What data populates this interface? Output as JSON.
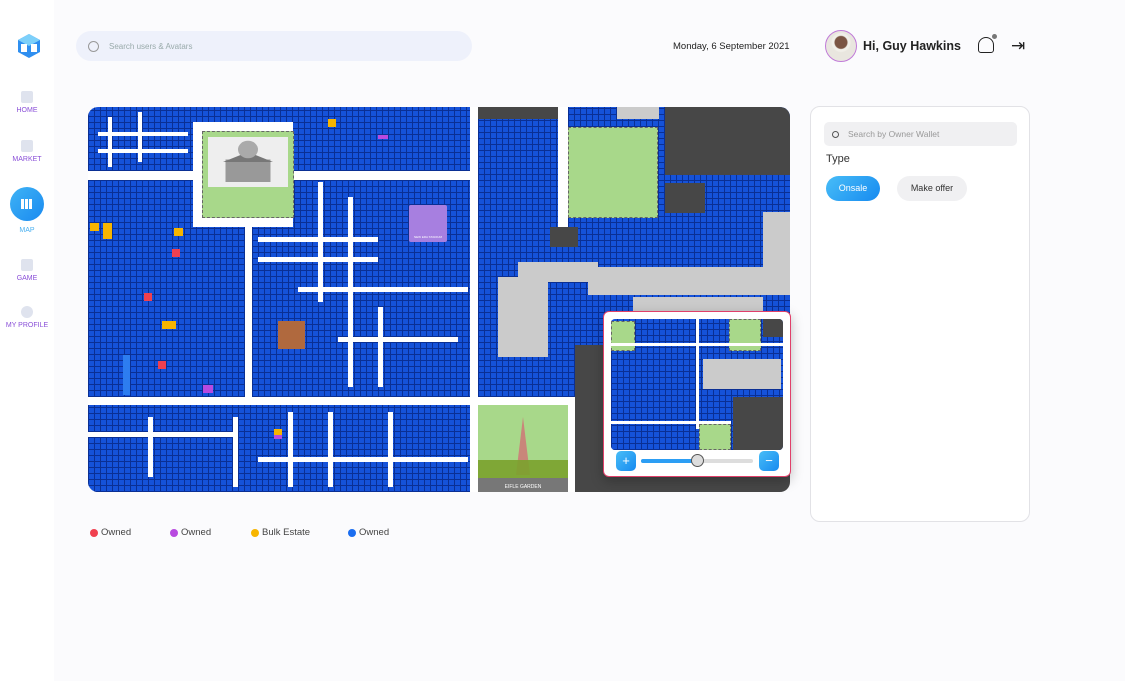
{
  "sidebar": {
    "items": [
      {
        "label": "HOME",
        "icon": "grid-icon"
      },
      {
        "label": "MARKET",
        "icon": "market-icon"
      },
      {
        "label": "MAP",
        "icon": "map-icon",
        "active": true
      },
      {
        "label": "GAME",
        "icon": "game-icon"
      },
      {
        "label": "MY PROFILE",
        "icon": "user-icon"
      }
    ]
  },
  "header": {
    "search_placeholder": "Search  users & Avatars",
    "date": "Monday, 6 September 2021",
    "greeting": "Hi, Guy Hawkins"
  },
  "map": {
    "landmark_label": "EIFLE GARDEN",
    "stadium_label": "NEW ERA STADIUM",
    "zoom_level": 0.5,
    "zoom_in": "+",
    "zoom_out": "−"
  },
  "filter": {
    "search_placeholder": "Search by Owner Wallet",
    "type_label": "Type",
    "options": [
      "Onsale",
      "Make offer"
    ],
    "selected": "Onsale"
  },
  "legend": [
    {
      "label": "Owned",
      "color": "#f0404f"
    },
    {
      "label": "Owned",
      "color": "#b84ae0"
    },
    {
      "label": "Bulk Estate",
      "color": "#f7b500"
    },
    {
      "label": "Owned",
      "color": "#1a6df0"
    }
  ],
  "colors": {
    "accent": "#1a8af0",
    "land": "#1552d9",
    "park": "#a8d88a",
    "road": "#ffffff",
    "reserved": "#474747"
  }
}
